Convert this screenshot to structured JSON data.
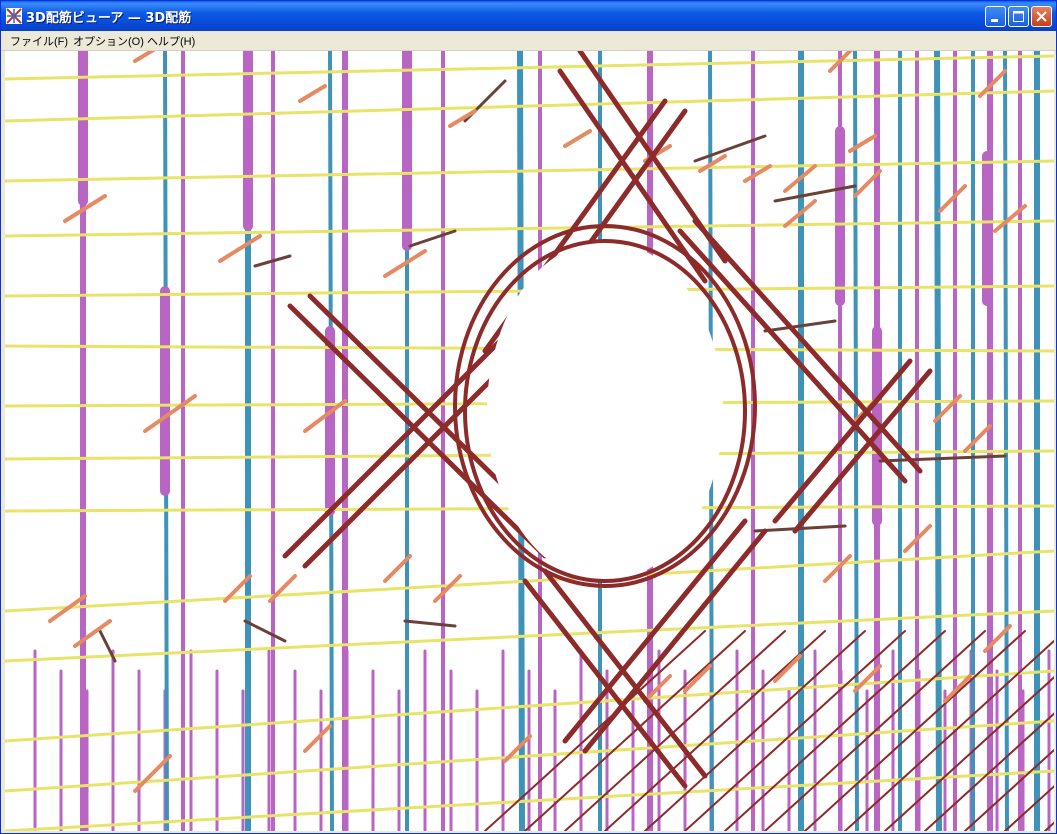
{
  "window": {
    "title": "3D配筋ビューア — 3D配筋",
    "controls": {
      "minimize": "minimize",
      "maximize": "maximize",
      "close": "close"
    }
  },
  "menu": {
    "items": [
      {
        "label": "ファイル(F)"
      },
      {
        "label": "オプション(O)"
      },
      {
        "label": "ヘルプ(H)"
      }
    ]
  },
  "colors": {
    "horizontal_bar": "#e9e36a",
    "vertical_bar_pink": "#b865c4",
    "vertical_bar_blue": "#3f93b8",
    "tie_bar": "#e58a62",
    "diagonal_bar": "#8d2a2a",
    "dark_link": "#6b4038",
    "opening": "#ffffff"
  },
  "scene": {
    "description_free": true,
    "opening": {
      "shape": "circle"
    }
  }
}
